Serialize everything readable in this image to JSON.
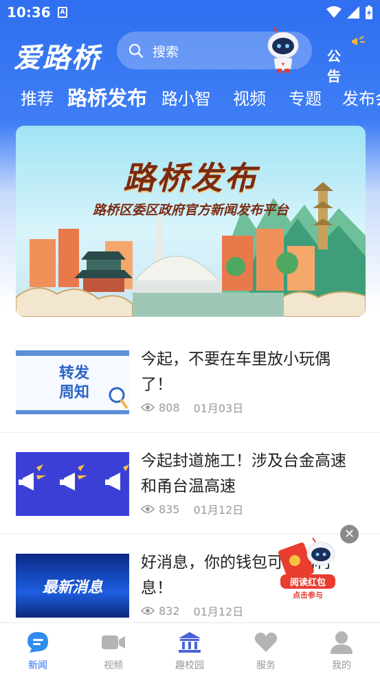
{
  "status_bar": {
    "time": "10:36"
  },
  "header": {
    "logo": "爱路桥",
    "search_placeholder": "搜索",
    "notice_label": "公告"
  },
  "tabs": [
    {
      "label": "推荐",
      "active": false
    },
    {
      "label": "路桥发布",
      "active": true
    },
    {
      "label": "路小智",
      "active": false
    },
    {
      "label": "视频",
      "active": false
    },
    {
      "label": "专题",
      "active": false
    },
    {
      "label": "发布会",
      "active": false
    }
  ],
  "banner": {
    "title": "路桥发布",
    "subtitle": "路桥区委区政府官方新闻发布平台"
  },
  "news": [
    {
      "title": "今起，不要在车里放小玩偶了！",
      "views": "808",
      "date": "01月03日",
      "thumb_text": "转发\n周知"
    },
    {
      "title": "今起封道施工！涉及台金高速和甬台温高速",
      "views": "835",
      "date": "01月12日"
    },
    {
      "title": "好消息，你的钱包可有福利息！",
      "views": "832",
      "date": "01月12日",
      "thumb_text": "最新消息"
    }
  ],
  "floating": {
    "label_top": "阅读红包",
    "label_bottom": "点击参与"
  },
  "bottom_nav": [
    {
      "label": "新闻",
      "icon": "news-bubble-icon",
      "active": true
    },
    {
      "label": "视频",
      "icon": "video-camera-icon",
      "active": false
    },
    {
      "label": "趣校园",
      "icon": "campus-building-icon",
      "active": false
    },
    {
      "label": "服务",
      "icon": "heart-service-icon",
      "active": false
    },
    {
      "label": "我的",
      "icon": "person-icon",
      "active": false
    }
  ],
  "colors": {
    "brand_blue": "#2f6ff0",
    "red": "#e83d2f"
  }
}
